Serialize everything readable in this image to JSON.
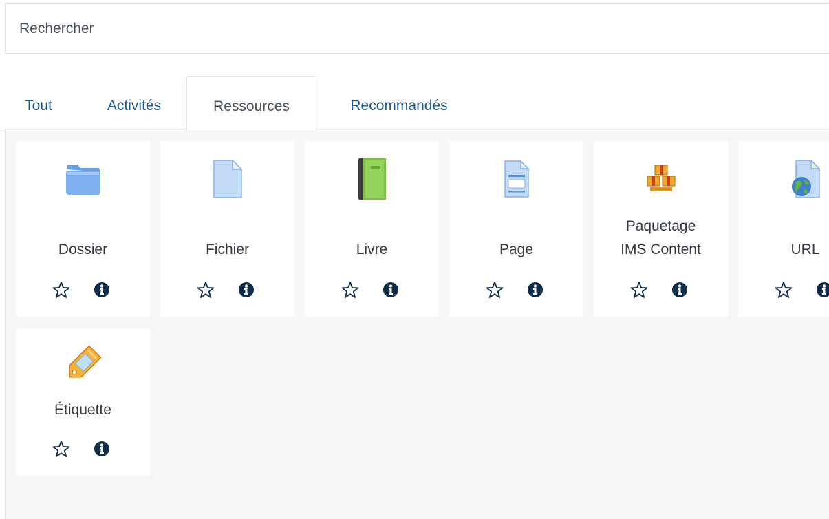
{
  "search": {
    "placeholder": "Rechercher"
  },
  "tabs": [
    {
      "label": "Tout",
      "active": false
    },
    {
      "label": "Activités",
      "active": false
    },
    {
      "label": "Ressources",
      "active": true
    },
    {
      "label": "Recommandés",
      "active": false
    }
  ],
  "modules": [
    {
      "name": "Dossier",
      "icon": "folder-icon"
    },
    {
      "name": "Fichier",
      "icon": "file-icon"
    },
    {
      "name": "Livre",
      "icon": "book-icon"
    },
    {
      "name": "Page",
      "icon": "page-icon"
    },
    {
      "name": "Paquetage",
      "name2": "IMS Content",
      "icon": "ims-package-icon"
    },
    {
      "name": "URL",
      "icon": "url-globe-icon"
    },
    {
      "name": "Étiquette",
      "icon": "label-tag-icon"
    }
  ],
  "colors": {
    "link": "#1d5b9d",
    "panel_bg": "#f5f7f9",
    "info_icon": "#0f2c49"
  }
}
